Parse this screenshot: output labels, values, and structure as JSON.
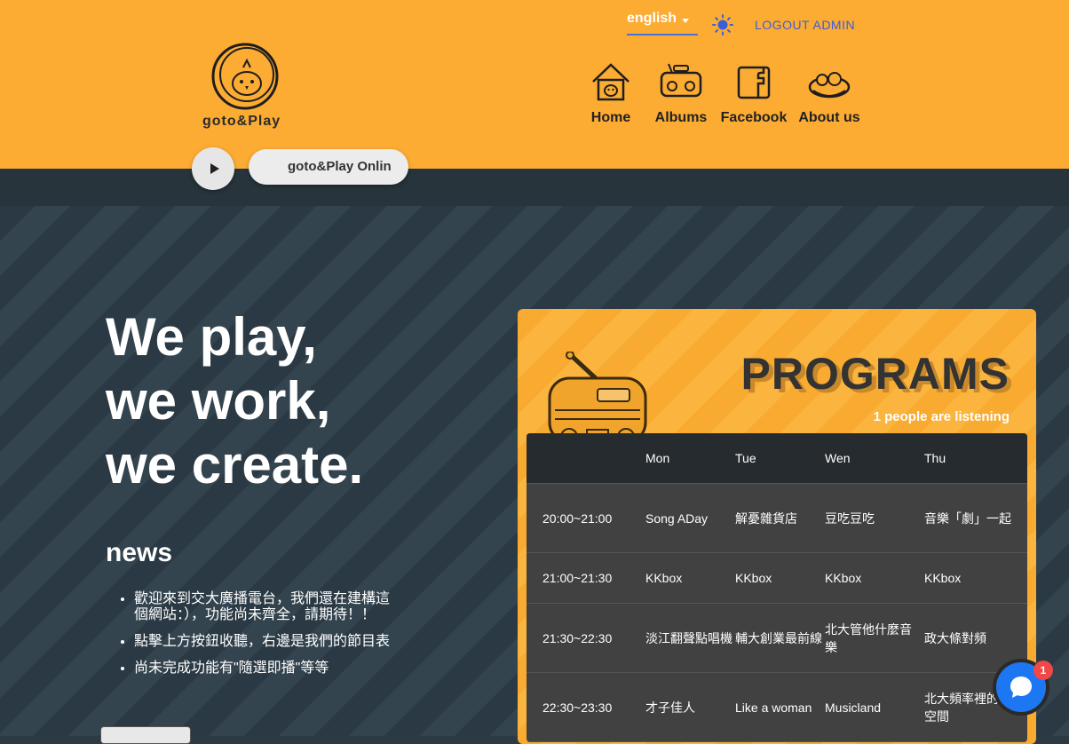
{
  "header": {
    "logo_text": "goto&Play",
    "language": "english",
    "logout_label": "LOGOUT ADMIN",
    "nav": [
      {
        "label": "Home",
        "icon": "home-icon"
      },
      {
        "label": "Albums",
        "icon": "radio-icon"
      },
      {
        "label": "Facebook",
        "icon": "facebook-icon"
      },
      {
        "label": "About us",
        "icon": "nest-icon"
      }
    ]
  },
  "player": {
    "now_playing": "goto&Play Onlin"
  },
  "hero": {
    "slogan": [
      "We play,",
      "we work,",
      "we create."
    ],
    "news_title": "news",
    "news": [
      "歡迎來到交大廣播電台，我們還在建構這個網站：），功能尚未齊全，請期待！！",
      "點擊上方按鈕收聽，右邊是我們的節目表",
      "尚未完成功能有\"隨選即播\"等等"
    ]
  },
  "programs": {
    "title": "PROGRAMS",
    "listening": "1 people are listening",
    "days": [
      "Mon",
      "Tue",
      "Wen",
      "Thu"
    ],
    "rows": [
      {
        "time": "20:00~21:00",
        "cells": [
          "Song ADay",
          "解憂雜貨店",
          "豆吃豆吃",
          "音樂「劇」一起"
        ]
      },
      {
        "time": "21:00~21:30",
        "cells": [
          "KKbox",
          "KKbox",
          "KKbox",
          "KKbox"
        ]
      },
      {
        "time": "21:30~22:30",
        "cells": [
          "淡江翻聲點唱機",
          "輔大創業最前線",
          "北大管他什麼音樂",
          "政大條對頻"
        ]
      },
      {
        "time": "22:30~23:30",
        "cells": [
          "才子佳人",
          "Like a woman",
          "Musicland",
          "北大頻率裡的獨立空間"
        ]
      }
    ]
  },
  "chat": {
    "badge": "1"
  },
  "colors": {
    "header_bg": "#fcab33",
    "accent_blue": "#3c5fd6",
    "dark": "#27343c"
  }
}
